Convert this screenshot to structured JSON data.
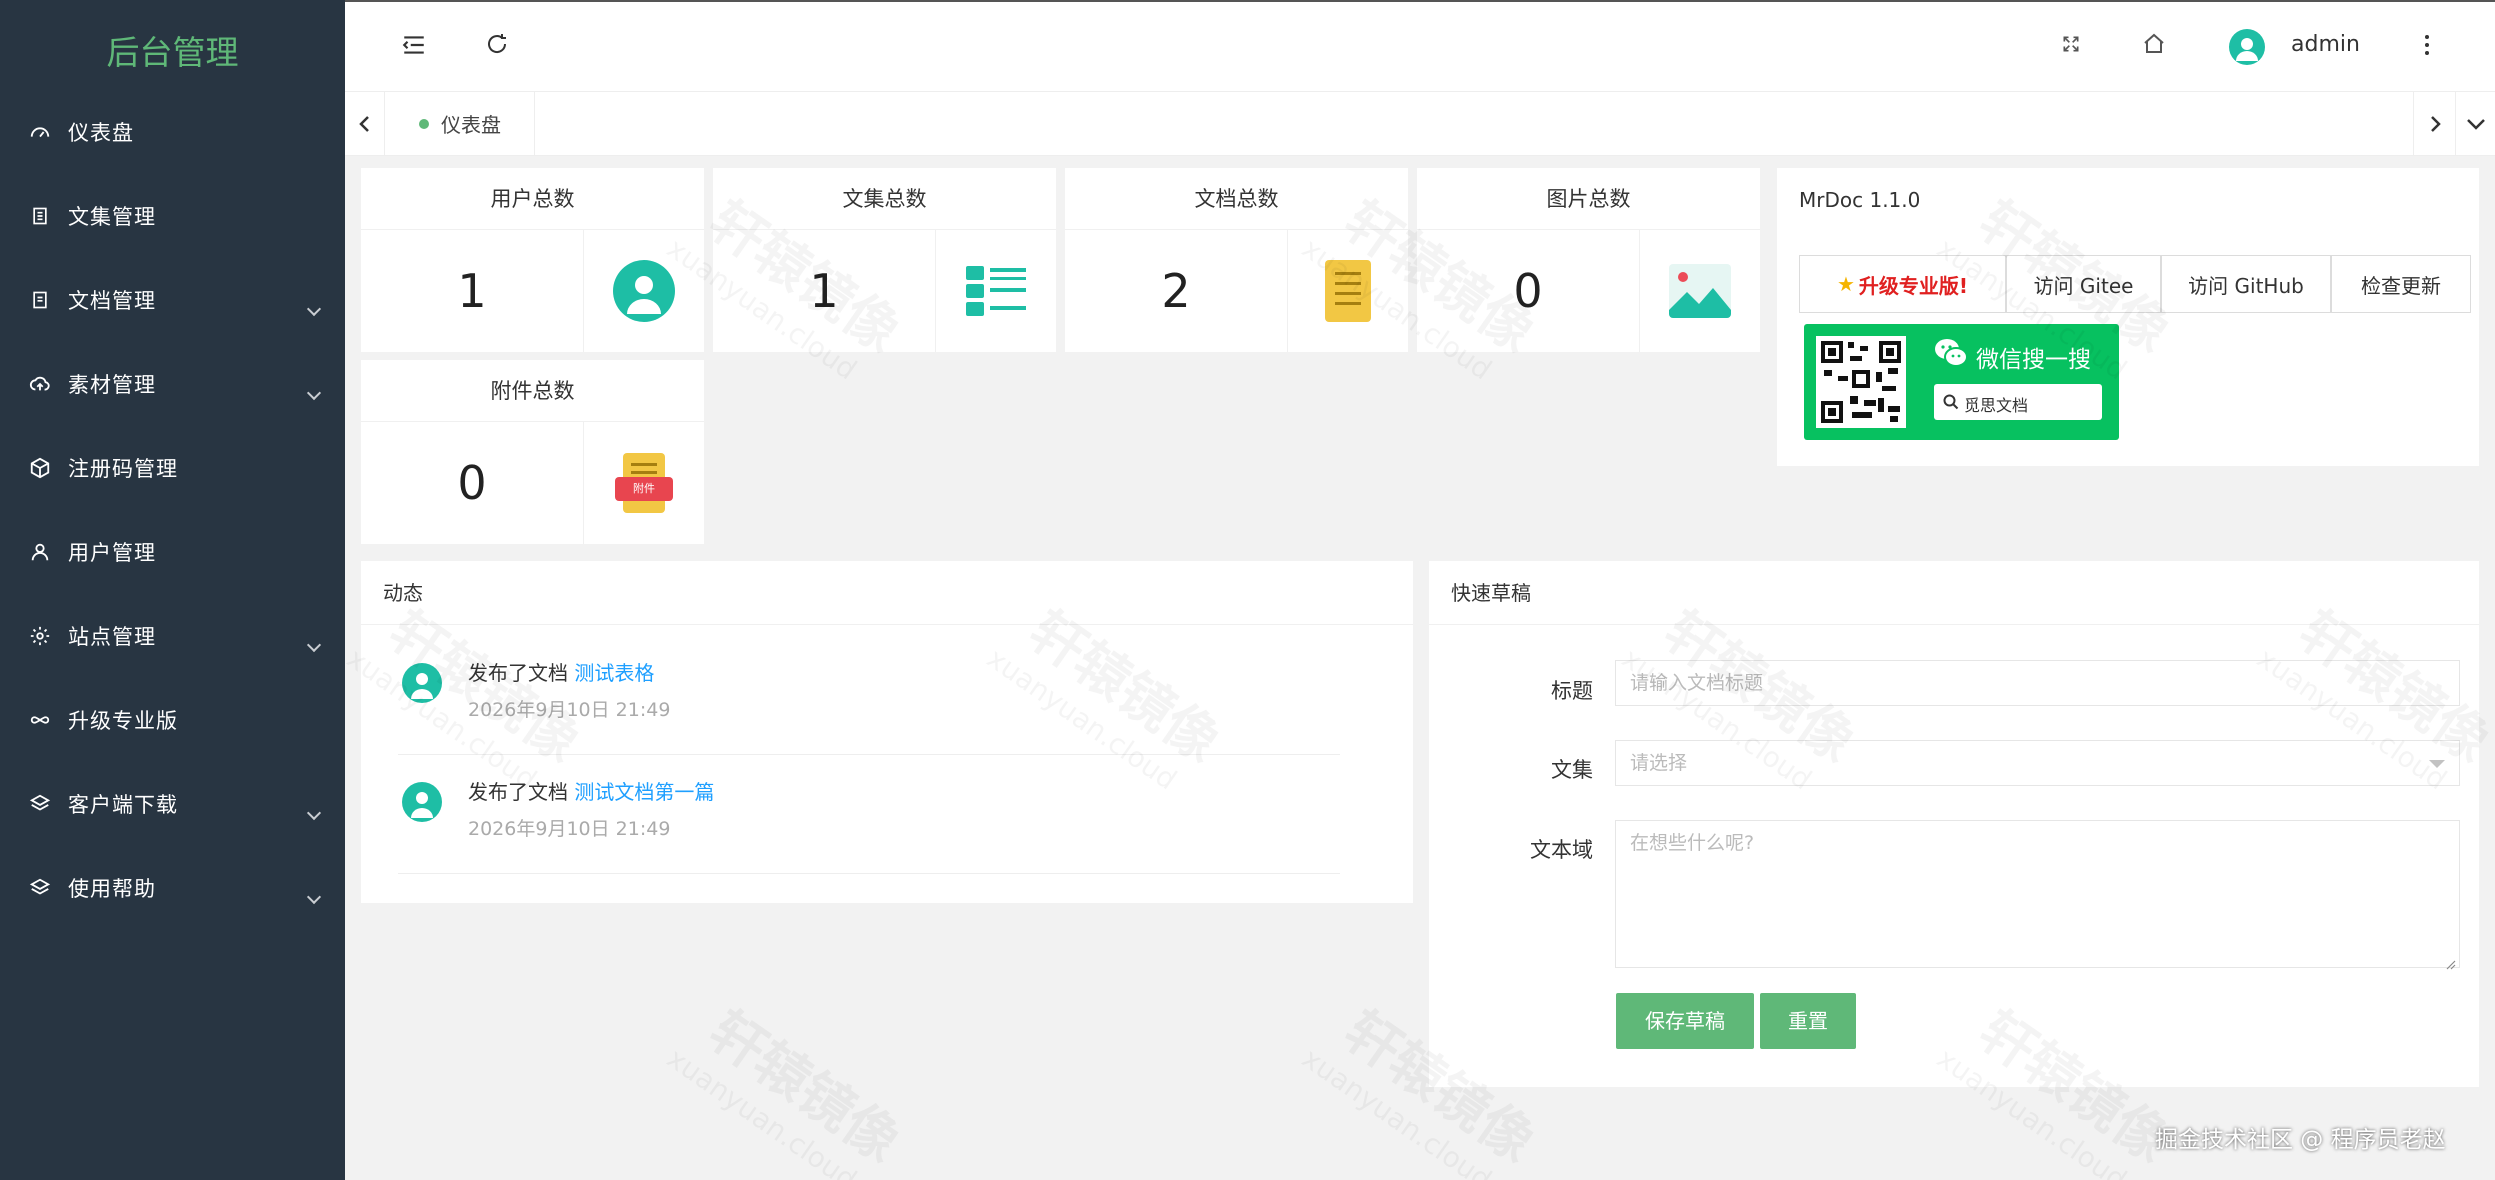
{
  "app": {
    "title": "后台管理"
  },
  "sidebar": {
    "items": [
      {
        "label": "仪表盘",
        "icon": "dashboard-icon",
        "has_children": false
      },
      {
        "label": "文集管理",
        "icon": "collection-icon",
        "has_children": false
      },
      {
        "label": "文档管理",
        "icon": "document-icon",
        "has_children": true
      },
      {
        "label": "素材管理",
        "icon": "cloud-upload-icon",
        "has_children": true
      },
      {
        "label": "注册码管理",
        "icon": "cube-icon",
        "has_children": false
      },
      {
        "label": "用户管理",
        "icon": "user-icon",
        "has_children": false
      },
      {
        "label": "站点管理",
        "icon": "gear-icon",
        "has_children": true
      },
      {
        "label": "升级专业版",
        "icon": "infinity-icon",
        "has_children": false
      },
      {
        "label": "客户端下载",
        "icon": "layers-icon",
        "has_children": true
      },
      {
        "label": "使用帮助",
        "icon": "layers-icon",
        "has_children": true
      }
    ]
  },
  "header": {
    "username": "admin"
  },
  "tabs": [
    {
      "label": "仪表盘",
      "active": true
    }
  ],
  "stats": [
    {
      "label": "用户总数",
      "value": "1",
      "icon": "user-avatar-icon"
    },
    {
      "label": "文集总数",
      "value": "1",
      "icon": "list-icon"
    },
    {
      "label": "文档总数",
      "value": "2",
      "icon": "document-icon"
    },
    {
      "label": "图片总数",
      "value": "0",
      "icon": "image-icon"
    },
    {
      "label": "附件总数",
      "value": "0",
      "icon": "attachment-icon",
      "icon_text": "附件"
    }
  ],
  "info": {
    "title": "MrDoc 1.1.0",
    "buttons": {
      "upgrade": "升级专业版!",
      "gitee": "访问 Gitee",
      "github": "访问 GitHub",
      "update": "检查更新"
    },
    "wechat": {
      "title": "微信搜一搜",
      "search": "觅思文档"
    }
  },
  "activity": {
    "title": "动态",
    "items": [
      {
        "action": "发布了文档",
        "link": "测试表格",
        "time": "2026年9月10日 21:49"
      },
      {
        "action": "发布了文档",
        "link": "测试文档第一篇",
        "time": "2026年9月10日 21:49"
      }
    ]
  },
  "draft": {
    "title": "快速草稿",
    "title_label": "标题",
    "title_placeholder": "请输入文档标题",
    "collection_label": "文集",
    "collection_placeholder": "请选择",
    "content_label": "文本域",
    "content_placeholder": "在想些什么呢?",
    "save_label": "保存草稿",
    "reset_label": "重置"
  },
  "watermark": {
    "text": "轩辕镜像",
    "sub": "xuanyuan.cloud"
  },
  "footer_credit": "掘金技术社区 @ 程序员老赵",
  "colors": {
    "sidebar_bg": "#283542",
    "accent_green": "#5fb878",
    "teal": "#1ebea5",
    "link_blue": "#1e9fff",
    "wechat_green": "#07c160"
  }
}
